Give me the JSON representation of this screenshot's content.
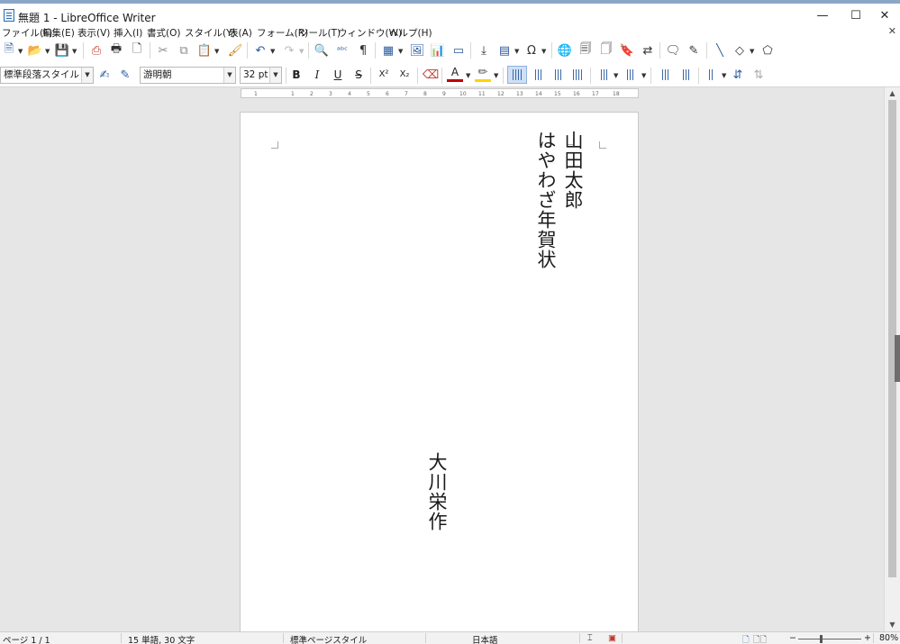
{
  "window": {
    "title": "無題 1 - LibreOffice Writer",
    "minimize": "—",
    "maximize": "☐",
    "close": "✕",
    "doc_close": "✕"
  },
  "menu": [
    "ファイル(F)",
    "編集(E)",
    "表示(V)",
    "挿入(I)",
    "書式(O)",
    "スタイル(Y)",
    "表(A)",
    "フォーム(R)",
    "ツール(T)",
    "ウィンドウ(W)",
    "ヘルプ(H)"
  ],
  "formatting": {
    "paragraph_style": "標準段落スタイル",
    "font_name": "游明朝",
    "font_size": "32 pt",
    "bold": "B",
    "italic": "I",
    "underline": "U",
    "strike": "S",
    "superscript": "X²",
    "subscript": "X₂"
  },
  "ruler": {
    "ticks": [
      "1",
      "1",
      "2",
      "3",
      "4",
      "5",
      "6",
      "7",
      "8",
      "9",
      "10",
      "11",
      "12",
      "13",
      "14",
      "15",
      "16",
      "17",
      "18"
    ]
  },
  "document": {
    "recipient": "山田太郎",
    "greeting": "はやわざ年賀状",
    "sender": "大川栄作"
  },
  "status": {
    "page": "ページ 1 / 1",
    "words": "15 単語, 30 文字",
    "page_style": "標準ページスタイル",
    "language": "日本語",
    "zoom": "80%",
    "zoom_level": 0.8,
    "zoom_minus": "−",
    "zoom_plus": "+"
  },
  "colors": {
    "accent": "#2f6db3",
    "font_color": "#c00000",
    "highlight": "#ffd400"
  },
  "icons": {
    "new": "new-document-icon",
    "open": "open-folder-icon",
    "save": "save-icon",
    "print": "print-icon",
    "find": "find-replace-icon",
    "special_char": "omega-icon"
  }
}
